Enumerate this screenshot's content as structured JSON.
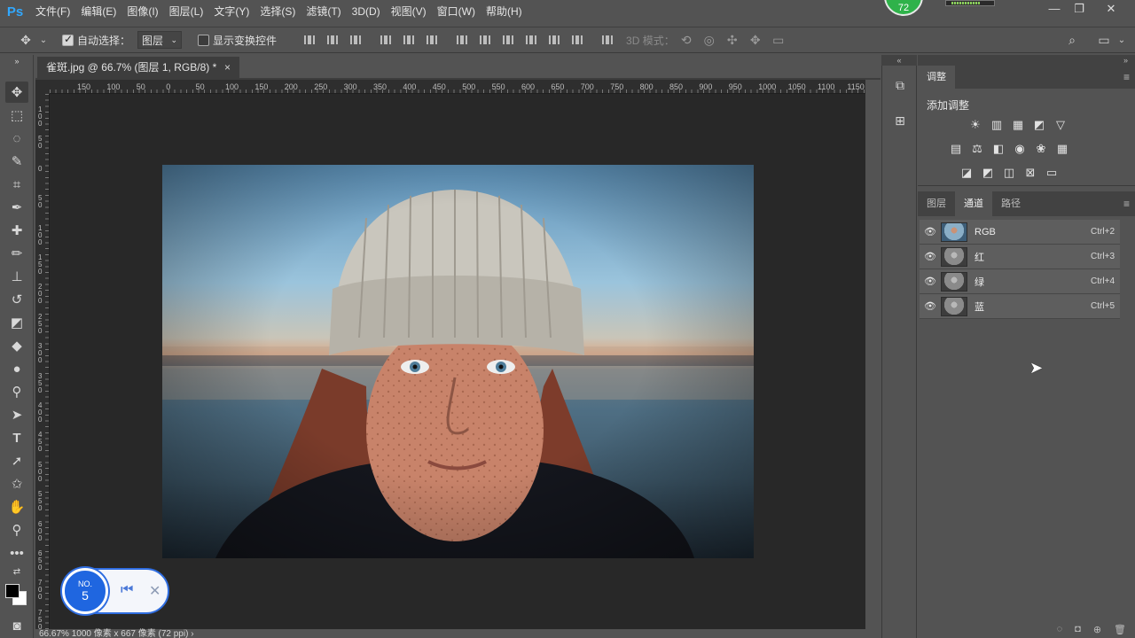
{
  "app": {
    "logo": "Ps"
  },
  "menubar": {
    "items": [
      "文件(F)",
      "编辑(E)",
      "图像(I)",
      "图层(L)",
      "文字(Y)",
      "选择(S)",
      "滤镜(T)",
      "3D(D)",
      "视图(V)",
      "窗口(W)",
      "帮助(H)"
    ],
    "perf_badge": "72",
    "window_buttons": [
      "—",
      "❐",
      "✕"
    ]
  },
  "options": {
    "move_icon": "move-icon",
    "auto_select_label": "自动选择：",
    "auto_select_checked": true,
    "auto_select_target": "图层",
    "show_transform_label": "显示变换控件",
    "show_transform_checked": false,
    "mode_3d_label": "3D 模式："
  },
  "document": {
    "tab_title": "雀斑.jpg @ 66.7% (图层 1, RGB/8) *",
    "tab_close": "×",
    "ruler_top_labels": [
      "150",
      "100",
      "50",
      "0",
      "50",
      "100",
      "150",
      "200",
      "250",
      "300",
      "350",
      "400",
      "450",
      "500",
      "550",
      "600",
      "650",
      "700",
      "750",
      "800",
      "850",
      "900",
      "950",
      "1000",
      "1050",
      "1100",
      "1150"
    ],
    "ruler_left_labels": [
      "100",
      "50",
      "0",
      "50",
      "100",
      "150",
      "200",
      "250",
      "300",
      "350",
      "400",
      "450",
      "500",
      "550",
      "600",
      "650",
      "700",
      "750",
      "800"
    ],
    "status": "66.67%     1000 像素 x 667 像素 (72 ppi)    ›"
  },
  "recording_widget": {
    "no_label": "NO.",
    "number": "5",
    "prev_icon": "skip-back-icon",
    "close_icon": "close-icon"
  },
  "panels": {
    "adjustments": {
      "tab": "调整",
      "add_label": "添加调整",
      "row1": [
        "☀",
        "▥",
        "▦",
        "◩",
        "▽"
      ],
      "row2": [
        "▤",
        "⚖",
        "◧",
        "◉",
        "❀",
        "▦"
      ],
      "row3": [
        "◪",
        "◩",
        "◫",
        "⊠",
        "▭"
      ]
    },
    "channels": {
      "tabs": [
        "图层",
        "通道",
        "路径"
      ],
      "active_tab": "通道",
      "rows": [
        {
          "name": "RGB",
          "shortcut": "Ctrl+2",
          "thumb": "rgb"
        },
        {
          "name": "红",
          "shortcut": "Ctrl+3",
          "thumb": "gray"
        },
        {
          "name": "绿",
          "shortcut": "Ctrl+4",
          "thumb": "gray"
        },
        {
          "name": "蓝",
          "shortcut": "Ctrl+5",
          "thumb": "gray"
        }
      ]
    }
  },
  "colors": {
    "accent_blue": "#1f66e0",
    "perf_green": "#2fb24a",
    "ps_blue": "#31a8ff"
  }
}
